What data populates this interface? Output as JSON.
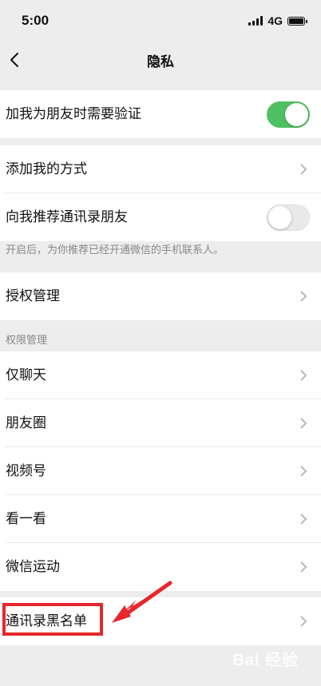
{
  "status_bar": {
    "time": "5:00",
    "network": "4G"
  },
  "nav": {
    "title": "隐私"
  },
  "rows": {
    "verify": {
      "label": "加我为朋友时需要验证",
      "toggle": "on"
    },
    "add_methods": {
      "label": "添加我的方式"
    },
    "recommend": {
      "label": "向我推荐通讯录朋友",
      "toggle": "off"
    },
    "recommend_hint": "开启后，为你推荐已经开通微信的手机联系人。",
    "auth": {
      "label": "授权管理"
    },
    "permissions_header": "权限管理",
    "chat_only": {
      "label": "仅聊天"
    },
    "moments": {
      "label": "朋友圈"
    },
    "channels": {
      "label": "视频号"
    },
    "top_stories": {
      "label": "看一看"
    },
    "werun": {
      "label": "微信运动"
    },
    "blacklist": {
      "label": "通讯录黑名单"
    }
  },
  "colors": {
    "toggle_on": "#4fc061",
    "annotation": "#e8262b",
    "background": "#ededed"
  },
  "watermark": "Bai 经验"
}
